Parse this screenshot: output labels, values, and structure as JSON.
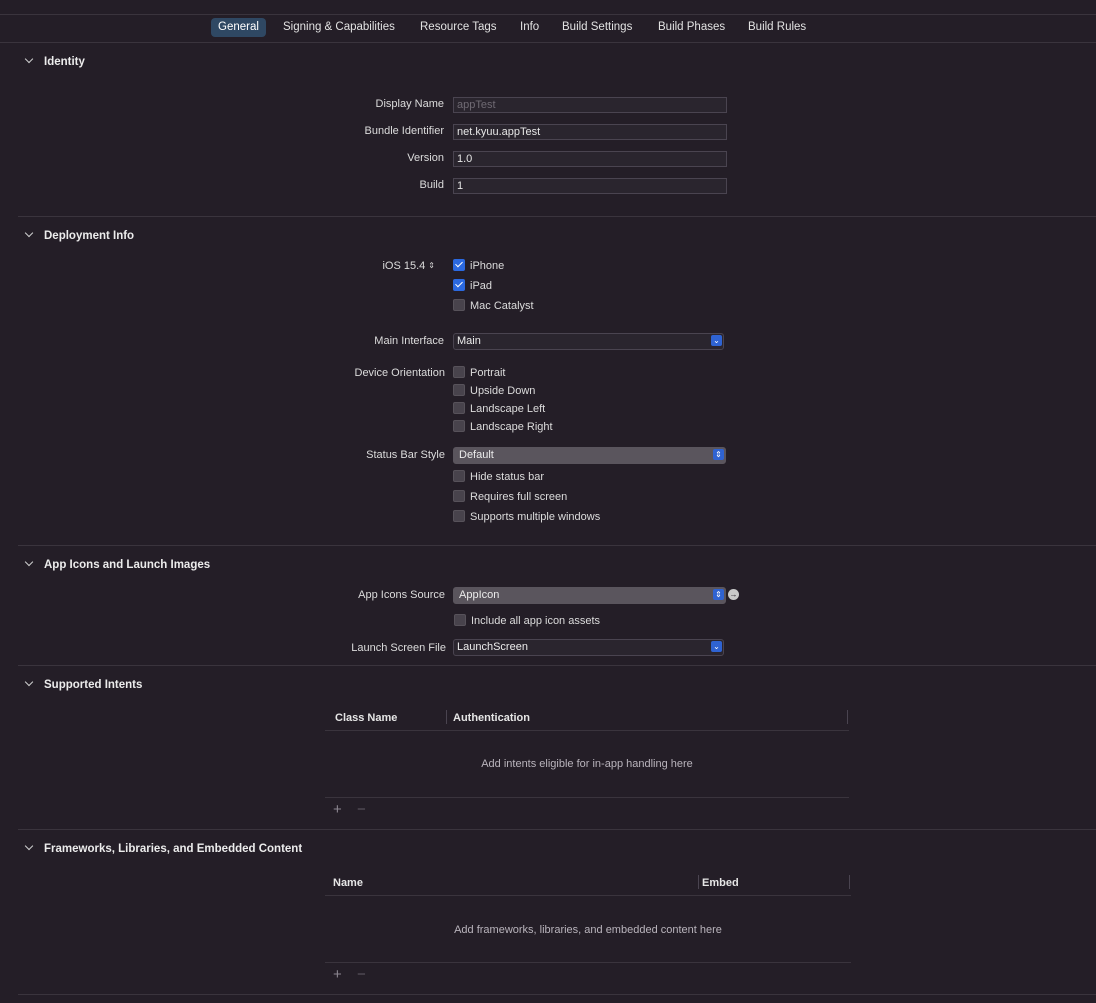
{
  "tabs": [
    {
      "label": "General",
      "active": true
    },
    {
      "label": "Signing & Capabilities"
    },
    {
      "label": "Resource Tags"
    },
    {
      "label": "Info"
    },
    {
      "label": "Build Settings"
    },
    {
      "label": "Build Phases"
    },
    {
      "label": "Build Rules"
    }
  ],
  "identity": {
    "title": "Identity",
    "display_name_label": "Display Name",
    "display_name_placeholder": "appTest",
    "bundle_id_label": "Bundle Identifier",
    "bundle_id_value": "net.kyuu.appTest",
    "version_label": "Version",
    "version_value": "1.0",
    "build_label": "Build",
    "build_value": "1"
  },
  "deployment": {
    "title": "Deployment Info",
    "ios_label": "iOS 15.4",
    "devices": [
      {
        "label": "iPhone",
        "checked": true
      },
      {
        "label": "iPad",
        "checked": true
      },
      {
        "label": "Mac Catalyst",
        "checked": false
      }
    ],
    "main_interface_label": "Main Interface",
    "main_interface_value": "Main",
    "orientation_label": "Device Orientation",
    "orientations": [
      {
        "label": "Portrait",
        "checked": false
      },
      {
        "label": "Upside Down",
        "checked": false
      },
      {
        "label": "Landscape Left",
        "checked": false
      },
      {
        "label": "Landscape Right",
        "checked": false
      }
    ],
    "status_bar_label": "Status Bar Style",
    "status_bar_value": "Default",
    "status_options": [
      {
        "label": "Hide status bar",
        "checked": false
      },
      {
        "label": "Requires full screen",
        "checked": false
      },
      {
        "label": "Supports multiple windows",
        "checked": false
      }
    ]
  },
  "icons": {
    "title": "App Icons and Launch Images",
    "source_label": "App Icons Source",
    "source_value": "AppIcon",
    "include_all_label": "Include all app icon assets",
    "launch_label": "Launch Screen File",
    "launch_value": "LaunchScreen"
  },
  "intents": {
    "title": "Supported Intents",
    "col1": "Class Name",
    "col2": "Authentication",
    "empty": "Add intents eligible for in-app handling here",
    "add": "+",
    "remove": "−"
  },
  "frameworks": {
    "title": "Frameworks, Libraries, and Embedded Content",
    "col1": "Name",
    "col2": "Embed",
    "empty": "Add frameworks, libraries, and embedded content here",
    "add": "+",
    "remove": "−"
  }
}
